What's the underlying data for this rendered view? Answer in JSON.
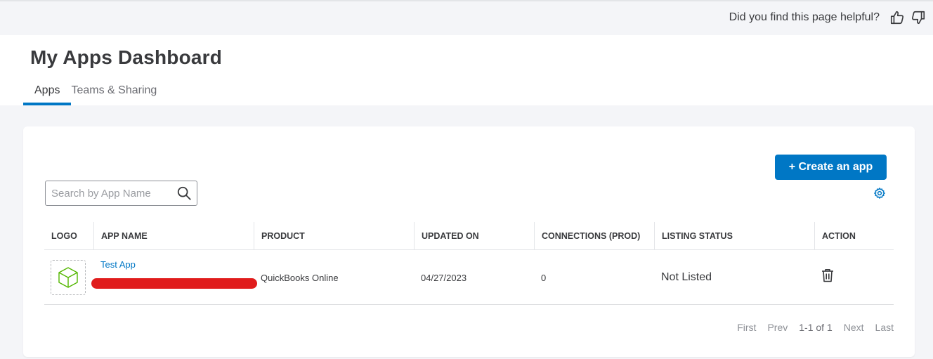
{
  "feedback": {
    "question": "Did you find this page helpful?"
  },
  "header": {
    "title": "My Apps Dashboard",
    "tabs": [
      {
        "label": "Apps",
        "active": true
      },
      {
        "label": "Teams & Sharing",
        "active": false
      }
    ]
  },
  "toolbar": {
    "create_label": "+ Create an app",
    "search_placeholder": "Search by App Name"
  },
  "table": {
    "columns": [
      "LOGO",
      "APP NAME",
      "PRODUCT",
      "UPDATED ON",
      "CONNECTIONS (PROD)",
      "LISTING STATUS",
      "ACTION"
    ],
    "rows": [
      {
        "app_name": "Test App",
        "product": "QuickBooks Online",
        "updated_on": "04/27/2023",
        "connections": "0",
        "listing_status": "Not Listed"
      }
    ]
  },
  "pagination": {
    "first": "First",
    "prev": "Prev",
    "range": "1-1 of 1",
    "next": "Next",
    "last": "Last"
  },
  "colors": {
    "accent": "#0077c5",
    "redaction": "#e01c1c",
    "logo_icon": "#53b700"
  }
}
